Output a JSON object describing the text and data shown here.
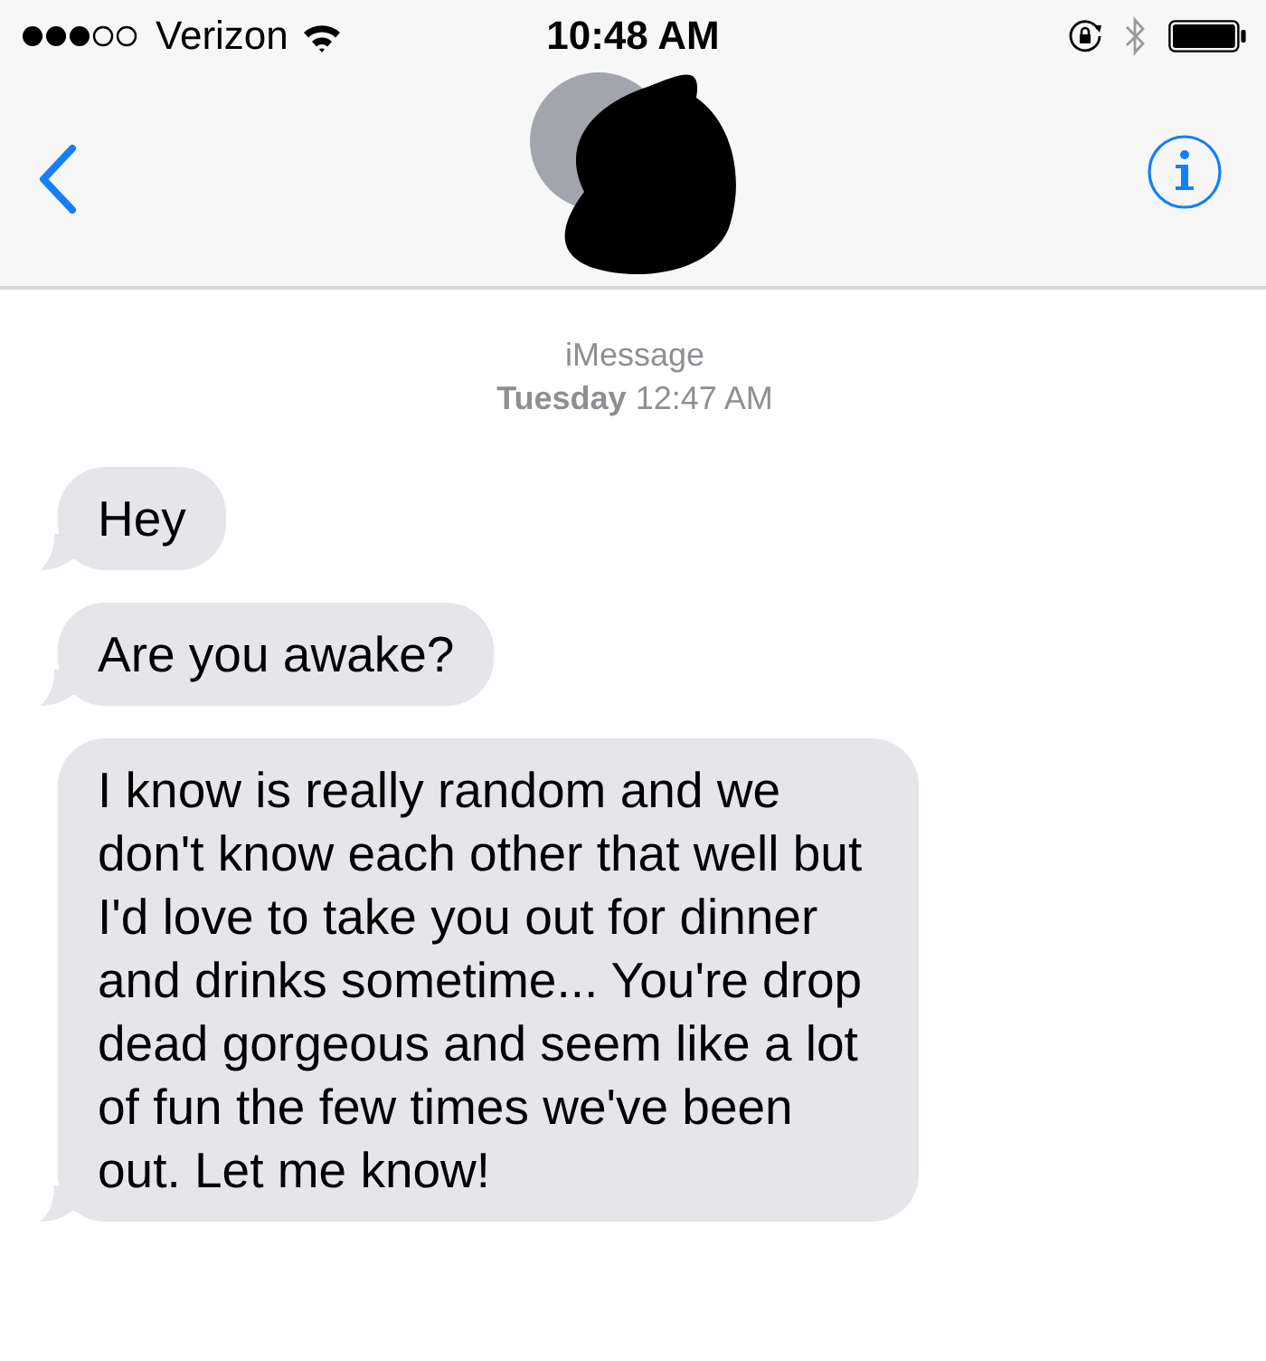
{
  "status_bar": {
    "carrier": "Verizon",
    "time": "10:48 AM"
  },
  "thread": {
    "service": "iMessage",
    "timestamp": "**Tuesday** 12:47 AM"
  },
  "messages": [
    {
      "text": "Hey",
      "incoming": true
    },
    {
      "text": "Are you awake?",
      "incoming": true
    },
    {
      "text": "I know is really random and we don't know each other that well but I'd love to take you out for dinner and drinks sometime... You're drop dead gorgeous and seem like a lot of fun the few times we've been out. Let me know!",
      "incoming": true
    }
  ]
}
